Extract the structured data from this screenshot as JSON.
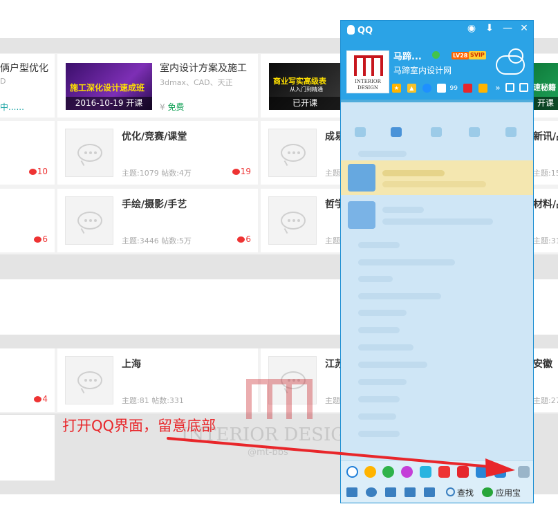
{
  "cards_row1": [
    {
      "title": "俩户型优化",
      "sub": "D",
      "status": "中......"
    },
    {
      "title": "室内设计方案及施工",
      "sub": "3dmax、CAD、天正",
      "banner_caption": "2016-10-19 开课",
      "banner_head": "施工深化设计速成班",
      "price_prefix": "¥",
      "price": "免费"
    },
    {
      "banner_caption": "已开课",
      "banner_head": "商业写实高级表",
      "banner_sub": "从入门到精通"
    },
    {
      "banner_caption": "开课",
      "banner_head": "速秘籍"
    }
  ],
  "forums_row2": [
    {
      "title": "",
      "replies": "10"
    },
    {
      "title": "优化/竞赛/课堂",
      "meta": "主题:1079  帖数:4万",
      "replies": "19"
    },
    {
      "title": "成易",
      "meta": "主题:"
    },
    {
      "title": "新讯/品",
      "meta": "主题:15"
    }
  ],
  "forums_row3": [
    {
      "title": "",
      "replies": "6"
    },
    {
      "title": "手绘/摄影/手艺",
      "meta": "主题:3446  帖数:5万",
      "replies": "6"
    },
    {
      "title": "哲学",
      "meta": "主题:"
    },
    {
      "title": "材料/品",
      "meta": "主题:31"
    }
  ],
  "regions_row": [
    {
      "title": "",
      "replies": "4"
    },
    {
      "title": "上海",
      "meta": "主题:81  帖数:331"
    },
    {
      "title": "江苏",
      "meta": "主题:"
    },
    {
      "title": "安徽",
      "meta": "主题:27"
    }
  ],
  "watermark": {
    "text": "INTERIOR DESIGN",
    "sub": "@mt-bbs"
  },
  "annotation": "打开QQ界面，留意底部",
  "qq": {
    "title": "QQ",
    "nickname": "马蹄...",
    "signature": "马蹄室内设计网",
    "level": "LV28",
    "vip": "SVIP",
    "mail_count": "99",
    "avatar_text": [
      "INTERIOR",
      "DESIGN"
    ],
    "footer": {
      "search_label": "查找",
      "appstore_label": "应用宝"
    },
    "footer_app_icons": [
      "browser-icon",
      "penguin-game-icon",
      "music-icon",
      "flower-icon",
      "video-play-icon",
      "stock-chart-icon",
      "jd-icon",
      "security-icon",
      "qq-security-icon",
      "app-manager-icon"
    ],
    "colors": {
      "header": "#2ba3e6",
      "footer": "#dceef9"
    }
  }
}
